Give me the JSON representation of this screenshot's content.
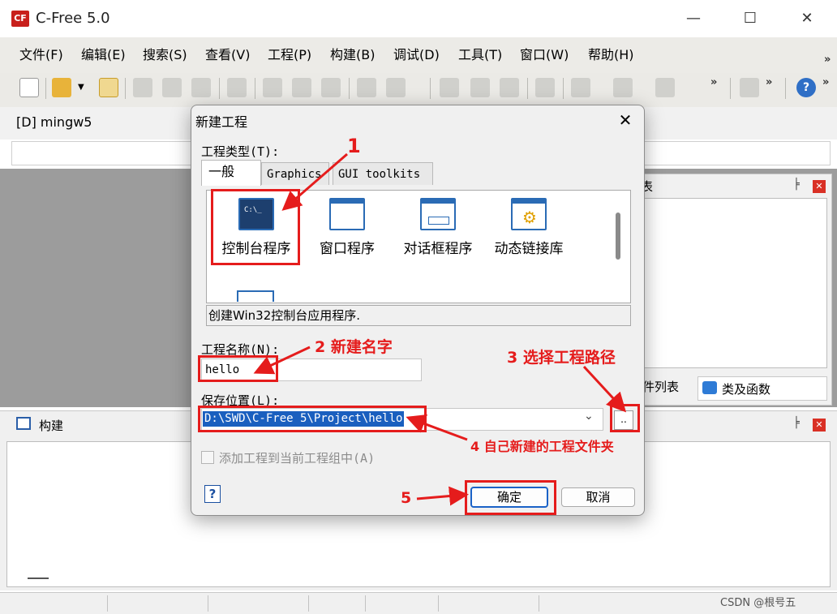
{
  "window": {
    "title": "C-Free 5.0",
    "logo": "CF"
  },
  "menu": [
    "文件(F)",
    "编辑(E)",
    "搜索(S)",
    "查看(V)",
    "工程(P)",
    "构建(B)",
    "调试(D)",
    "工具(T)",
    "窗口(W)",
    "帮助(H)"
  ],
  "compiler": "[D] mingw5",
  "right_panel": {
    "title_fragment": "表",
    "tab_files": "件列表",
    "tab_classes": "类及函数"
  },
  "build_panel": {
    "title": "构建"
  },
  "dialog": {
    "title": "新建工程",
    "type_label": "工程类型(T):",
    "tabs": [
      "一般",
      "Graphics",
      "GUI toolkits"
    ],
    "types": [
      "控制台程序",
      "窗口程序",
      "对话框程序",
      "动态链接库"
    ],
    "description": "创建Win32控制台应用程序.",
    "name_label": "工程名称(N):",
    "name_value": "hello",
    "location_label": "保存位置(L):",
    "location_value": "D:\\SWD\\C-Free 5\\Project\\hello",
    "browse": "..",
    "add_to_group": "添加工程到当前工程组中(A)",
    "help": "?",
    "ok": "确定",
    "cancel": "取消"
  },
  "annotations": {
    "a1": "1",
    "a2": "2 新建名字",
    "a3": "3 选择工程路径",
    "a4": "4 自己新建的工程文件夹",
    "a5": "5"
  },
  "watermark": "CSDN @根号五",
  "colors": {
    "annotation": "#e51c1c",
    "accent": "#1a5fbf"
  }
}
